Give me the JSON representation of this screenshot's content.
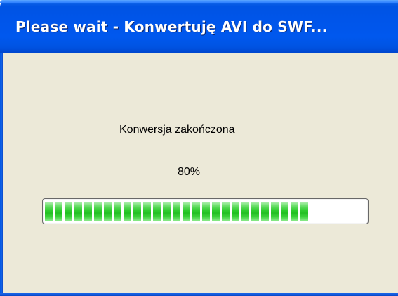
{
  "window": {
    "title": "Please wait - Konwertuję AVI do SWF..."
  },
  "dialog": {
    "status": "Konwersja zakończona",
    "percent_label": "80%"
  },
  "progress": {
    "value": 0.8325,
    "color_fill": "#2fcc2f",
    "color_track": "#ffffff"
  },
  "theme": {
    "titlebar": "#0054e3",
    "client_background": "#ece9d8"
  }
}
